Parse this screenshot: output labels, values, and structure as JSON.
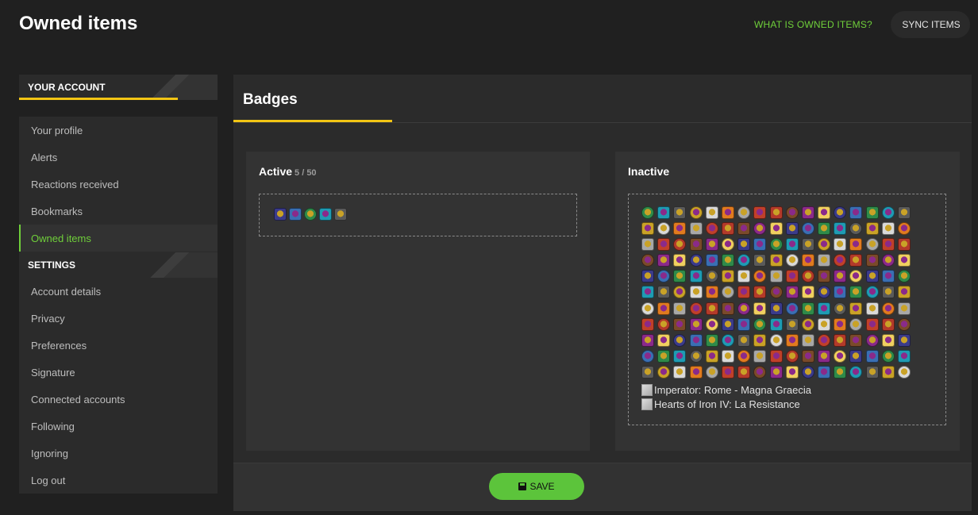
{
  "header": {
    "title": "Owned items",
    "help_link": "WHAT IS OWNED ITEMS?",
    "sync_button": "SYNC ITEMS"
  },
  "sidebar": {
    "account_heading": "YOUR ACCOUNT",
    "account_items": [
      {
        "label": "Your profile"
      },
      {
        "label": "Alerts"
      },
      {
        "label": "Reactions received"
      },
      {
        "label": "Bookmarks"
      },
      {
        "label": "Owned items",
        "active": true
      }
    ],
    "settings_heading": "SETTINGS",
    "settings_items": [
      {
        "label": "Account details"
      },
      {
        "label": "Privacy"
      },
      {
        "label": "Preferences"
      },
      {
        "label": "Signature"
      },
      {
        "label": "Connected accounts"
      },
      {
        "label": "Following"
      },
      {
        "label": "Ignoring"
      },
      {
        "label": "Log out"
      }
    ]
  },
  "main": {
    "title": "Badges",
    "active": {
      "title": "Active",
      "count": "5 / 50",
      "badge_count": 5
    },
    "inactive": {
      "title": "Inactive",
      "badge_grid_count": 187,
      "broken_images": [
        "Imperator: Rome - Magna Graecia",
        "Hearts of Iron IV: La Resistance"
      ]
    },
    "save_button": "SAVE"
  },
  "colors": {
    "background": "#202020",
    "panel": "#2b2b2b",
    "accent_yellow": "#f2c514",
    "accent_green": "#6fcf3a",
    "save_green": "#5cc43b"
  }
}
